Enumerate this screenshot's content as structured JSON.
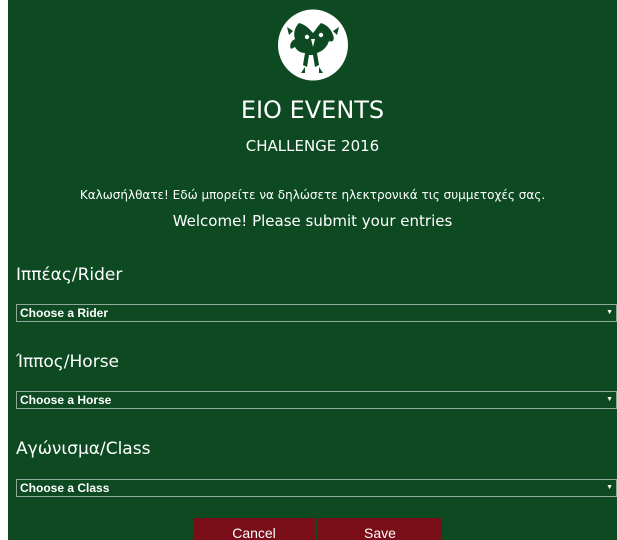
{
  "header": {
    "title": "EIO EVENTS",
    "subtitle": "CHALLENGE 2016",
    "welcome_gr": "Καλωσήλθατε! Εδώ μπορείτε να δηλώσετε ηλεκτρονικά τις συμμετοχές σας.",
    "welcome_en": "Welcome! Please submit your entries"
  },
  "form": {
    "rider": {
      "label": "Ιππέας/Rider",
      "selected": "Choose a Rider"
    },
    "horse": {
      "label": "Ίππος/Horse",
      "selected": "Choose a Horse"
    },
    "class": {
      "label": "Αγώνισμα/Class",
      "selected": "Choose a Class"
    }
  },
  "actions": {
    "cancel_label": "Cancel",
    "save_label": "Save"
  },
  "icons": {
    "logo": "horses-logo-icon",
    "dropdown": "dropdown-arrow-icon"
  },
  "colors": {
    "background": "#0d4a22",
    "button": "#7a0e18",
    "text": "#ffffff"
  }
}
